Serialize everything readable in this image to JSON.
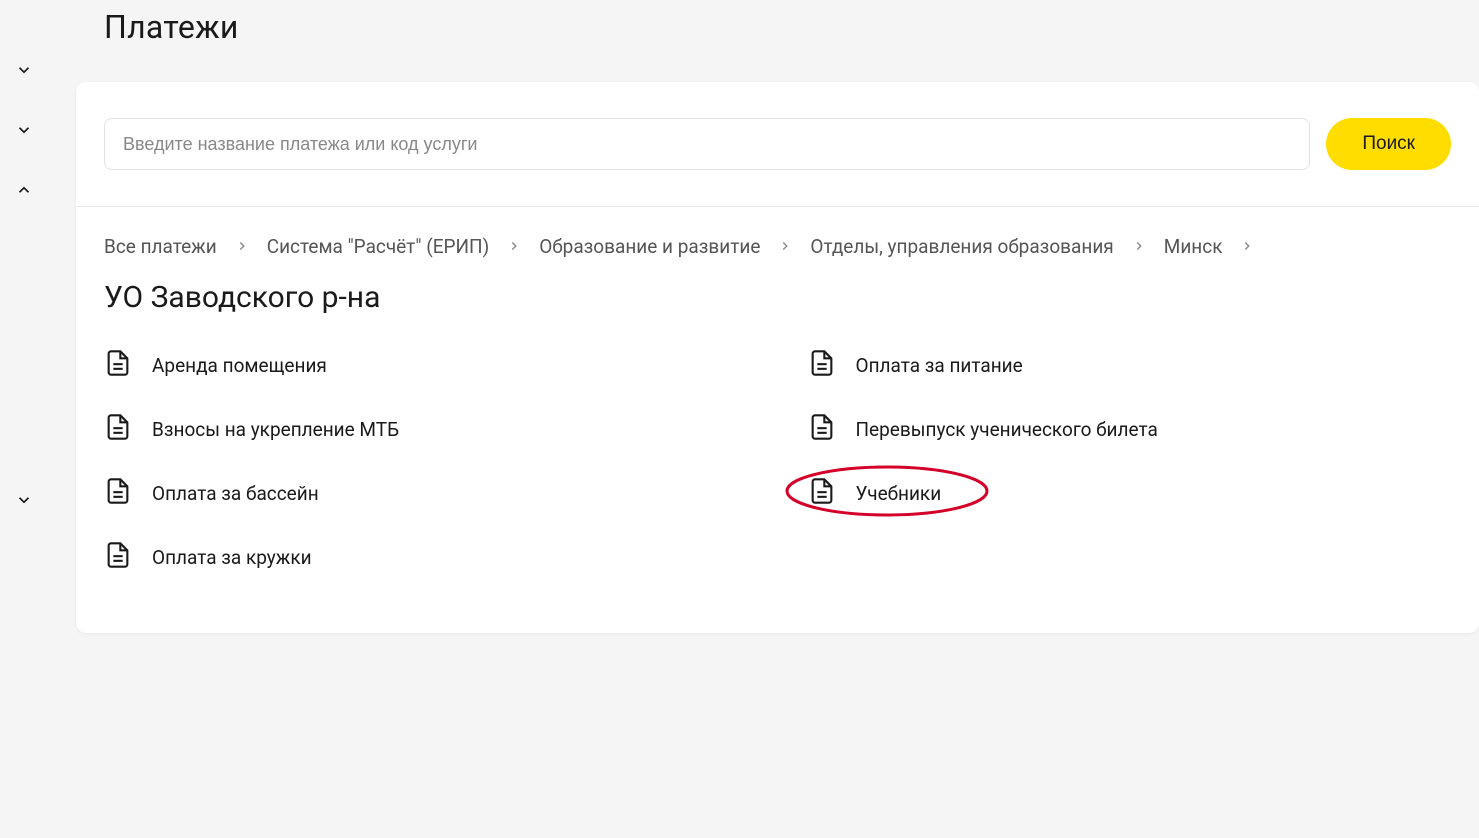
{
  "page_title": "Платежи",
  "search": {
    "placeholder": "Введите название платежа или код услуги",
    "button": "Поиск"
  },
  "breadcrumbs": [
    "Все платежи",
    "Система \"Расчёт\" (ЕРИП)",
    "Образование и развитие",
    "Отделы, управления образования",
    "Минск"
  ],
  "category_title": "УО Заводского р-на",
  "items_left": [
    "Аренда помещения",
    "Взносы на укрепление МТБ",
    "Оплата за бассейн",
    "Оплата за кружки"
  ],
  "items_right": [
    "Оплата за питание",
    "Перевыпуск ученического билета",
    "Учебники"
  ],
  "highlighted_item": "Учебники",
  "sidebar_chevrons": [
    "down",
    "down",
    "up",
    "down"
  ]
}
